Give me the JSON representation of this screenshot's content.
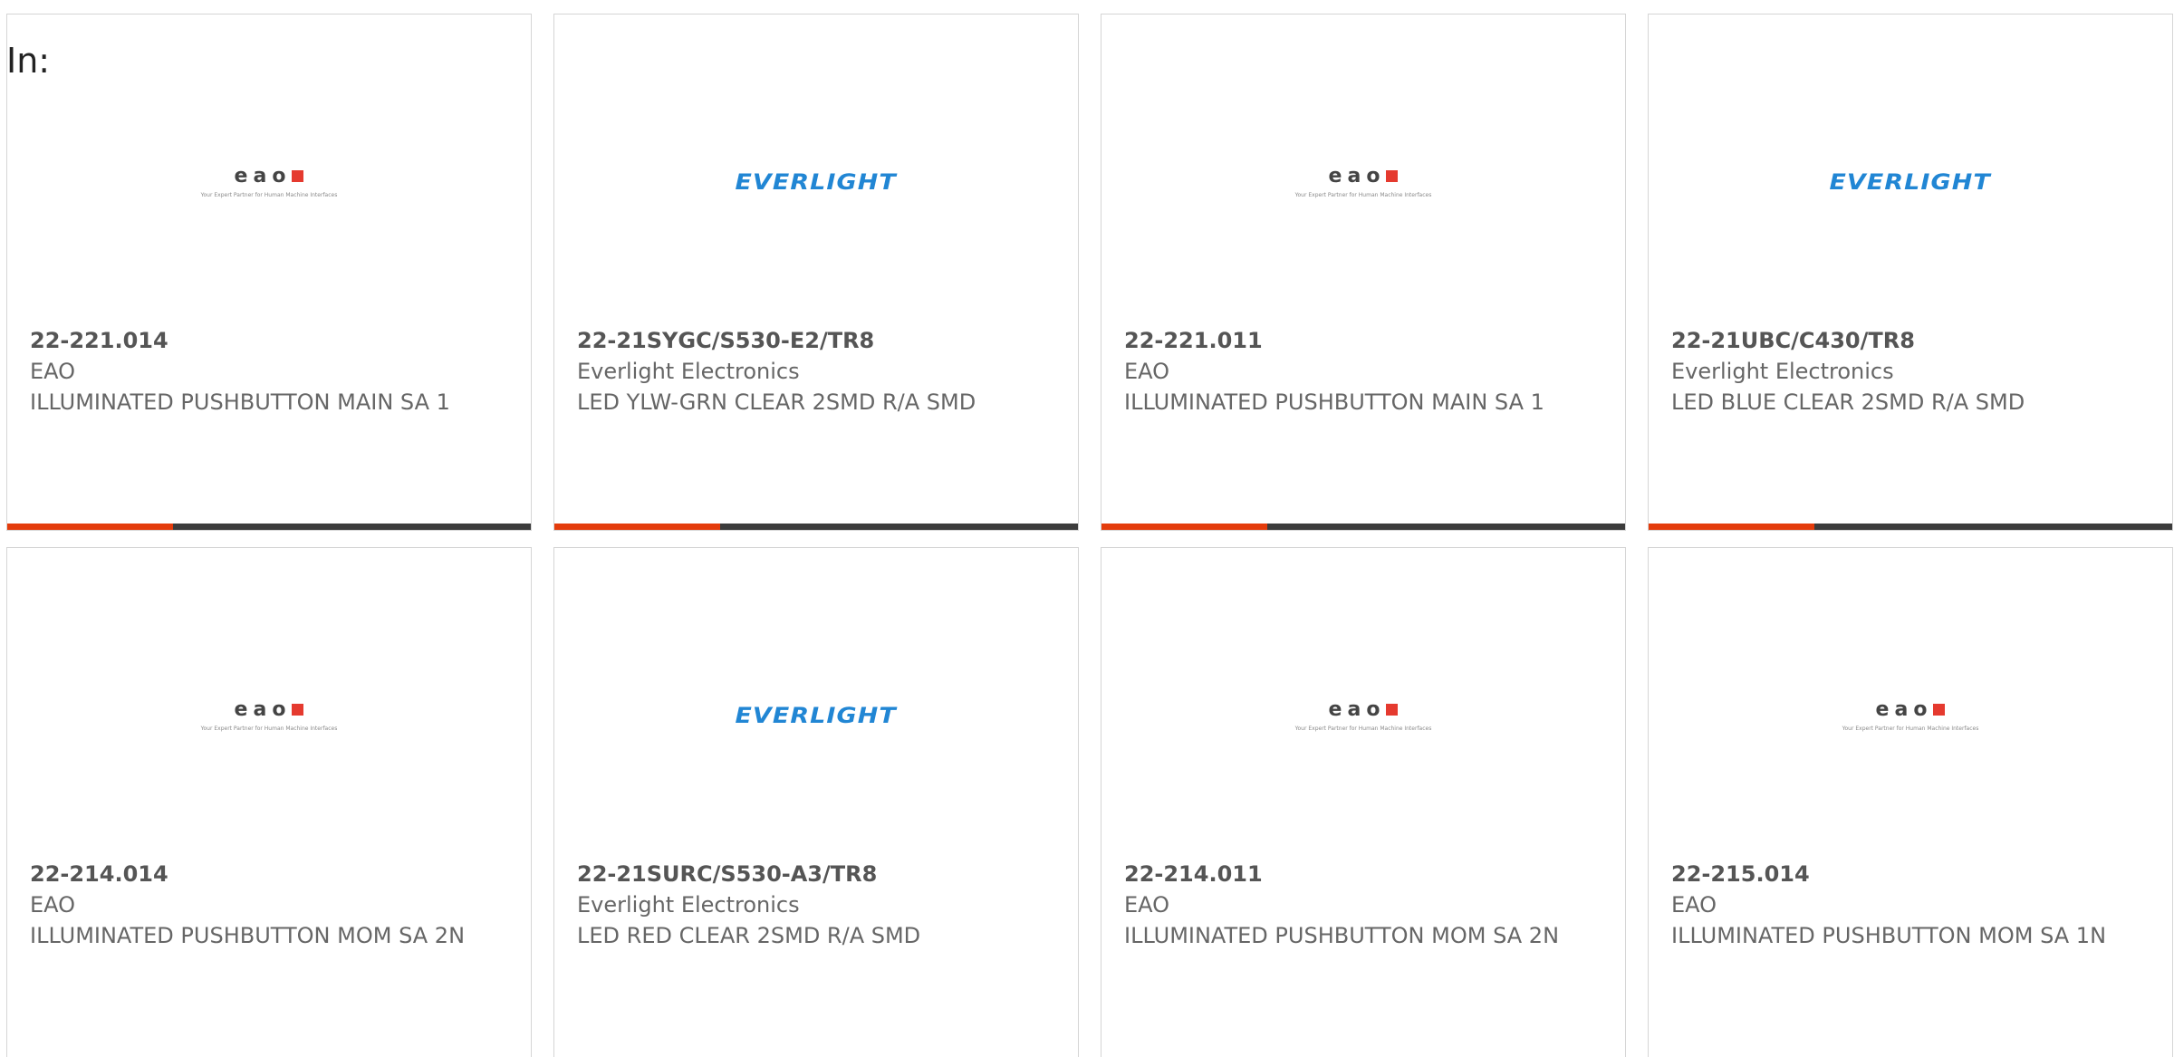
{
  "filter_label": "In:",
  "products": [
    {
      "part_number": "22-221.014",
      "manufacturer": "EAO",
      "description": "ILLUMINATED PUSHBUTTON MAIN SA 1",
      "logo": "eao",
      "logo_text": "eao",
      "logo_tagline": "Your Expert Partner for Human Machine Interfaces"
    },
    {
      "part_number": "22-21SYGC/S530-E2/TR8",
      "manufacturer": "Everlight Electronics",
      "description": "LED YLW-GRN CLEAR 2SMD R/A SMD",
      "logo": "everlight",
      "logo_text": "EVERLIGHT"
    },
    {
      "part_number": "22-221.011",
      "manufacturer": "EAO",
      "description": "ILLUMINATED PUSHBUTTON MAIN SA 1",
      "logo": "eao",
      "logo_text": "eao",
      "logo_tagline": "Your Expert Partner for Human Machine Interfaces"
    },
    {
      "part_number": "22-21UBC/C430/TR8",
      "manufacturer": "Everlight Electronics",
      "description": "LED BLUE CLEAR 2SMD R/A SMD",
      "logo": "everlight",
      "logo_text": "EVERLIGHT"
    },
    {
      "part_number": "22-214.014",
      "manufacturer": "EAO",
      "description": "ILLUMINATED PUSHBUTTON MOM SA 2N",
      "logo": "eao",
      "logo_text": "eao",
      "logo_tagline": "Your Expert Partner for Human Machine Interfaces"
    },
    {
      "part_number": "22-21SURC/S530-A3/TR8",
      "manufacturer": "Everlight Electronics",
      "description": "LED RED CLEAR 2SMD R/A SMD",
      "logo": "everlight",
      "logo_text": "EVERLIGHT"
    },
    {
      "part_number": "22-214.011",
      "manufacturer": "EAO",
      "description": "ILLUMINATED PUSHBUTTON MOM SA 2N",
      "logo": "eao",
      "logo_text": "eao",
      "logo_tagline": "Your Expert Partner for Human Machine Interfaces"
    },
    {
      "part_number": "22-215.014",
      "manufacturer": "EAO",
      "description": "ILLUMINATED PUSHBUTTON MOM SA 1N",
      "logo": "eao",
      "logo_text": "eao",
      "logo_tagline": "Your Expert Partner for Human Machine Interfaces"
    }
  ],
  "colors": {
    "accent_bar": "#e43c0c",
    "dark_bar": "#3c3c3c",
    "everlight_blue": "#2186d4",
    "eao_red": "#e53a2f"
  }
}
